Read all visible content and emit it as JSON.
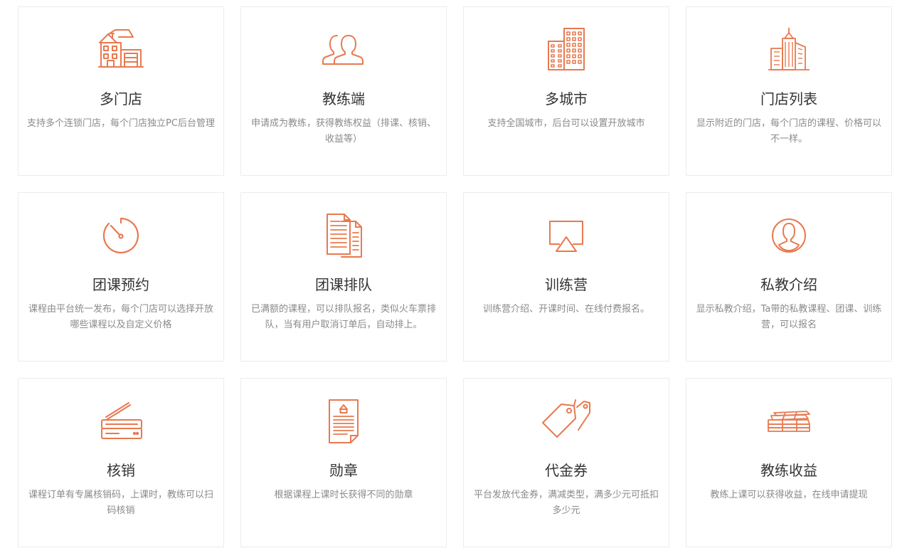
{
  "accent_color": "#e8794f",
  "cards": [
    {
      "icon": "store-building-icon",
      "title": "多门店",
      "desc": "支持多个连锁门店，每个门店独立PC后台管理"
    },
    {
      "icon": "users-icon",
      "title": "教练端",
      "desc": "申请成为教练，获得教练权益（排课、核销、收益等）"
    },
    {
      "icon": "city-buildings-icon",
      "title": "多城市",
      "desc": "支持全国城市，后台可以设置开放城市"
    },
    {
      "icon": "skyscrapers-icon",
      "title": "门店列表",
      "desc": "显示附近的门店，每个门店的课程、价格可以不一样。"
    },
    {
      "icon": "timer-gauge-icon",
      "title": "团课预约",
      "desc": "课程由平台统一发布，每个门店可以选择开放哪些课程以及自定义价格"
    },
    {
      "icon": "documents-icon",
      "title": "团课排队",
      "desc": "已满额的课程，可以排队报名，类似火车票排队，当有用户取消订单后，自动排上。"
    },
    {
      "icon": "airplay-screen-icon",
      "title": "训练营",
      "desc": "训练营介绍、开课时间、在线付费报名。"
    },
    {
      "icon": "user-circle-icon",
      "title": "私教介绍",
      "desc": "显示私教介绍，Ta带的私教课程、团课、训练营，可以报名"
    },
    {
      "icon": "scanner-icon",
      "title": "核销",
      "desc": "课程订单有专属核销码，上课时，教练可以扫码核销"
    },
    {
      "icon": "certificate-document-icon",
      "title": "勋章",
      "desc": "根据课程上课时长获得不同的勋章"
    },
    {
      "icon": "price-tags-icon",
      "title": "代金券",
      "desc": "平台发放代金券，满减类型，满多少元可抵扣多少元"
    },
    {
      "icon": "money-stack-icon",
      "title": "教练收益",
      "desc": "教练上课可以获得收益，在线申请提现"
    }
  ]
}
